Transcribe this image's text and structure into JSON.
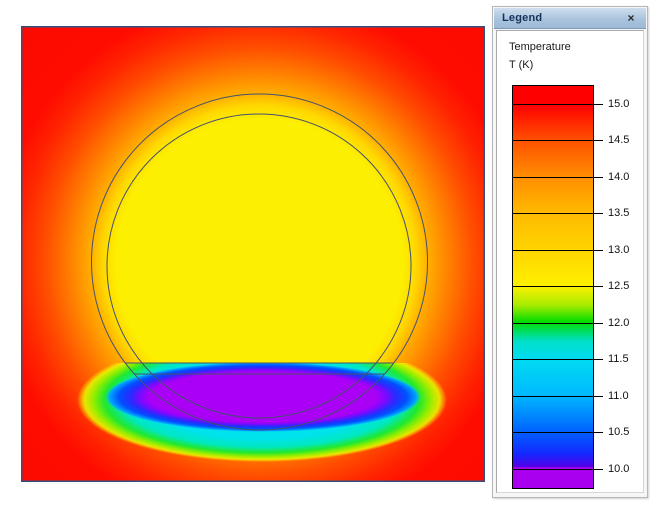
{
  "window": {
    "background_color": "#FFFFFF"
  },
  "plot": {
    "kind": "2D temperature field contour plot",
    "border_color": "#35507F",
    "geometry_outline_color": "#44506E",
    "field_colors": {
      "hot_wall": "#FF0B00",
      "orange_mid": "#FF8E00",
      "bulk_yellow": "#FCF000",
      "green_fringe": "#20E830",
      "cyan_fringe": "#00E2EC",
      "blue_ring": "#2A2AFF",
      "cold_core_purple": "#AA00F5"
    }
  },
  "legend": {
    "title": "Legend",
    "close_label": "×",
    "quantity": "Temperature",
    "unit_label": "T (K)",
    "titlebar_top_color": "#CFDEEE",
    "titlebar_bottom_color": "#9DB9D6",
    "colorbar": {
      "tick_start_pct": 4.7,
      "tick_step_pct": 9.03,
      "ticks": [
        "15.0",
        "14.5",
        "14.0",
        "13.5",
        "13.0",
        "12.5",
        "12.0",
        "11.5",
        "11.0",
        "10.5",
        "10.0"
      ],
      "gradient_stops": [
        {
          "pos": 0,
          "color": "#FF0000"
        },
        {
          "pos": 4.7,
          "color": "#FF0000"
        },
        {
          "pos": 13.7,
          "color": "#FF5200"
        },
        {
          "pos": 22.7,
          "color": "#FF8E00"
        },
        {
          "pos": 31.7,
          "color": "#FFBA00"
        },
        {
          "pos": 40.7,
          "color": "#FFD400"
        },
        {
          "pos": 49.7,
          "color": "#FFF000"
        },
        {
          "pos": 54.5,
          "color": "#A8EC00"
        },
        {
          "pos": 58.7,
          "color": "#00DC00"
        },
        {
          "pos": 63.5,
          "color": "#00E0C8"
        },
        {
          "pos": 67.7,
          "color": "#00DCF0"
        },
        {
          "pos": 76.7,
          "color": "#00BAFF"
        },
        {
          "pos": 85.7,
          "color": "#0064FF"
        },
        {
          "pos": 91.5,
          "color": "#1428FF"
        },
        {
          "pos": 94.6,
          "color": "#5000E6"
        },
        {
          "pos": 95.0,
          "color": "#AA00F0"
        },
        {
          "pos": 100,
          "color": "#AA00F0"
        }
      ]
    }
  },
  "chart_data": {
    "type": "heatmap",
    "title": "Temperature",
    "unit": "T (K)",
    "scale_ticks": [
      15.0,
      14.5,
      14.0,
      13.5,
      13.0,
      12.5,
      12.0,
      11.5,
      11.0,
      10.5,
      10.0
    ],
    "scale_range_shown": [
      10.0,
      15.0
    ],
    "observed_regions": [
      {
        "region": "square domain walls and corners",
        "approx_value": 15.0
      },
      {
        "region": "annulus between outer and inner circle",
        "approx_value_range": [
          13.0,
          14.0
        ]
      },
      {
        "region": "uniform interior of circle above liquid line",
        "approx_value": 13.0
      },
      {
        "region": "cold lens-shaped pool below chord at circle bottom",
        "approx_value": 10.0
      }
    ]
  }
}
